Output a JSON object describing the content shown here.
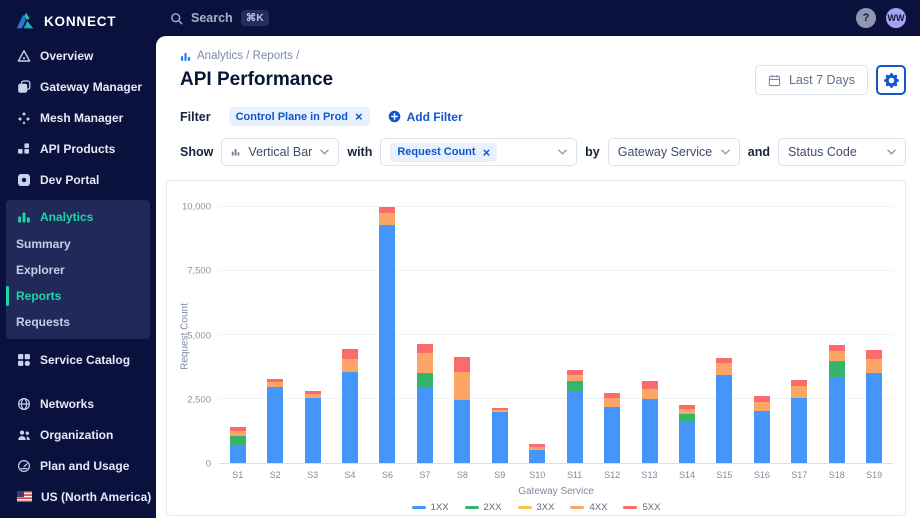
{
  "colors": {
    "sidebar_bg": "#0A113C",
    "panel_bg": "#20295A",
    "accent_teal": "#1FD6A6",
    "accent_blue": "#1456CB",
    "chip_bg": "#E8F2FE"
  },
  "sidebar": {
    "logo": "KONNECT",
    "main_items": [
      {
        "label": "Overview",
        "icon": "overview-icon"
      },
      {
        "label": "Gateway Manager",
        "icon": "gateway-icon"
      },
      {
        "label": "Mesh Manager",
        "icon": "mesh-icon"
      },
      {
        "label": "API Products",
        "icon": "api-products-icon"
      },
      {
        "label": "Dev Portal",
        "icon": "dev-portal-icon"
      }
    ],
    "analytics_section": {
      "label": "Analytics",
      "icon": "analytics-icon",
      "children": [
        {
          "label": "Summary",
          "active": false
        },
        {
          "label": "Explorer",
          "active": false
        },
        {
          "label": "Reports",
          "active": true
        },
        {
          "label": "Requests",
          "active": false
        }
      ]
    },
    "secondary_items": [
      {
        "label": "Service Catalog",
        "icon": "service-catalog-icon"
      }
    ],
    "bottom_items": [
      {
        "label": "Networks",
        "icon": "networks-icon"
      },
      {
        "label": "Organization",
        "icon": "organization-icon"
      },
      {
        "label": "Plan and Usage",
        "icon": "plan-usage-icon"
      },
      {
        "label": "US (North America)",
        "icon": "us-flag-icon",
        "has_selector": true
      }
    ]
  },
  "topbar": {
    "search_label": "Search",
    "shortcut": "⌘K",
    "help_label": "?",
    "avatar_initials": "WW"
  },
  "header": {
    "breadcrumb": "Analytics / Reports /",
    "title": "API Performance",
    "date_range": "Last 7 Days"
  },
  "filter": {
    "label": "Filter",
    "chip": "Control Plane in Prod",
    "chip_close": "×",
    "add_label": "Add Filter"
  },
  "controls": {
    "show_label": "Show",
    "chart_type": "Vertical Bar",
    "with_label": "with",
    "metric_chip": "Request Count",
    "metric_chip_close": "×",
    "by_label": "by",
    "group_by": "Gateway Service",
    "and_label": "and",
    "second_group": "Status Code"
  },
  "chart_data": {
    "type": "bar",
    "stacked": true,
    "xlabel": "Gateway Service",
    "ylabel": "Request Count",
    "ylim": [
      0,
      10000
    ],
    "yticks": [
      0,
      2500,
      5000,
      7500,
      10000
    ],
    "ytick_labels": [
      "0",
      "2,500",
      "5,000",
      "7,500",
      "10,000"
    ],
    "grid": true,
    "legend_position": "bottom",
    "categories": [
      "S1",
      "S2",
      "S3",
      "S4",
      "S6",
      "S7",
      "S8",
      "S9",
      "S10",
      "S11",
      "S12",
      "S13",
      "S14",
      "S15",
      "S16",
      "S17",
      "S18",
      "S19"
    ],
    "series": [
      {
        "name": "1XX",
        "color": "#4596FA",
        "values": [
          700,
          2950,
          2550,
          3550,
          9300,
          2950,
          2450,
          2000,
          500,
          2800,
          2200,
          2500,
          1600,
          3450,
          2050,
          2550,
          3350,
          3500
        ]
      },
      {
        "name": "2XX",
        "color": "#35B56A",
        "values": [
          350,
          0,
          0,
          0,
          0,
          550,
          0,
          0,
          0,
          400,
          0,
          0,
          300,
          0,
          0,
          0,
          620,
          0
        ]
      },
      {
        "name": "3XX",
        "color": "#F7C64B",
        "values": [
          0,
          0,
          0,
          0,
          0,
          0,
          0,
          0,
          0,
          0,
          0,
          0,
          0,
          0,
          0,
          0,
          0,
          0
        ]
      },
      {
        "name": "4XX",
        "color": "#FDA566",
        "values": [
          200,
          200,
          150,
          500,
          450,
          800,
          1100,
          60,
          125,
          250,
          350,
          400,
          200,
          450,
          350,
          450,
          390,
          550
        ]
      },
      {
        "name": "5XX",
        "color": "#FA6C6C",
        "values": [
          150,
          150,
          100,
          400,
          250,
          350,
          600,
          90,
          100,
          200,
          200,
          300,
          150,
          200,
          200,
          250,
          240,
          350
        ]
      }
    ]
  }
}
